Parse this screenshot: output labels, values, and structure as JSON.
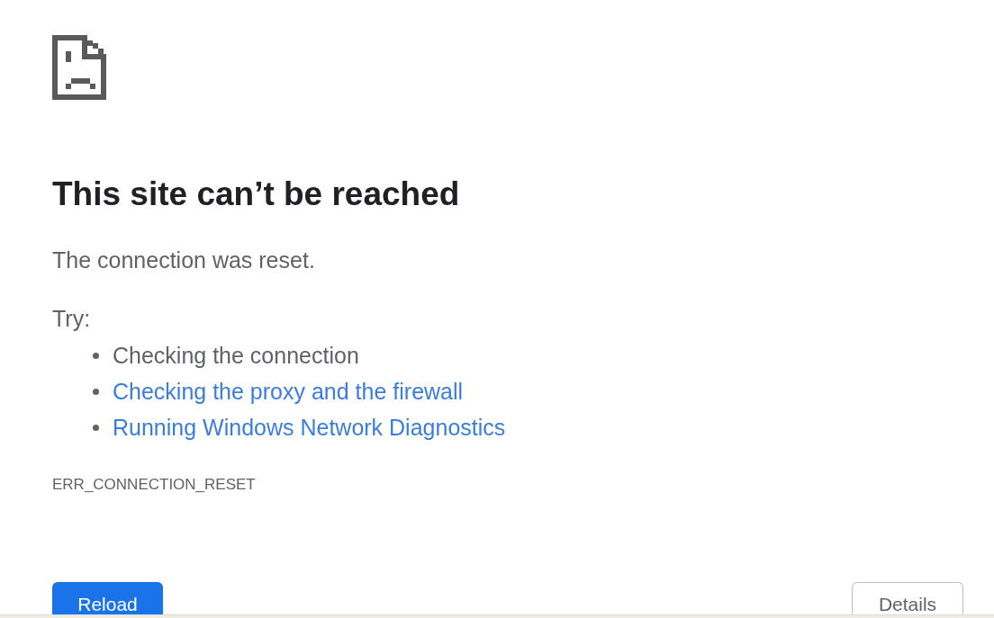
{
  "heading": "This site can’t be reached",
  "message": "The connection was reset.",
  "suggestions": {
    "label": "Try:",
    "items": [
      {
        "text": "Checking the connection",
        "kind": "text"
      },
      {
        "text": "Checking the proxy and the firewall",
        "kind": "link"
      },
      {
        "text": "Running Windows Network Diagnostics",
        "kind": "link"
      }
    ]
  },
  "error_code": "ERR_CONNECTION_RESET",
  "buttons": [
    {
      "label": "Reload",
      "kind": "primary"
    },
    {
      "label": "Details",
      "kind": "secondary"
    }
  ]
}
